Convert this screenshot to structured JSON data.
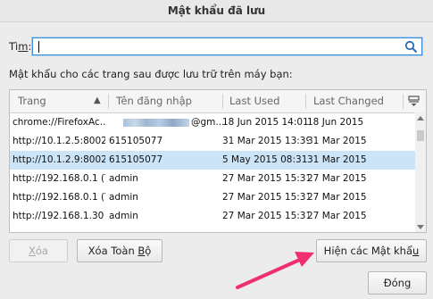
{
  "window": {
    "title": "Mật khẩu đã lưu"
  },
  "search": {
    "label_prefix": "Tì",
    "label_accel": "m",
    "label_suffix": ":",
    "value": ""
  },
  "description": "Mật khẩu cho các trang sau được lưu trữ trên máy bạn:",
  "table": {
    "columns": [
      "Trang",
      "Tên đăng nhập",
      "Last Used",
      "Last Changed"
    ],
    "sort": {
      "column": "Trang",
      "direction": "ascending"
    },
    "rows": [
      {
        "site": "chrome://FirefoxAc...",
        "username": "@gm...",
        "last_used": "18 Jun 2015 14:01",
        "last_changed": "18 Jun 2015",
        "selected": false
      },
      {
        "site": "http://10.1.2.5:8002",
        "username": "615105077",
        "last_used": "31 Mar 2015 13:39",
        "last_changed": "31 Mar 2015",
        "selected": false
      },
      {
        "site": "http://10.1.2.9:8002",
        "username": "615105077",
        "last_used": "5 May 2015 08:31",
        "last_changed": "31 Mar 2015",
        "selected": true
      },
      {
        "site": "http://192.168.0.1 (T...",
        "username": "admin",
        "last_used": "27 Mar 2015 15:31",
        "last_changed": "27 Mar 2015",
        "selected": false
      },
      {
        "site": "http://192.168.0.1 (T...",
        "username": "admin",
        "last_used": "27 Mar 2015 15:31",
        "last_changed": "27 Mar 2015",
        "selected": false
      },
      {
        "site": "http://192.168.1.30",
        "username": "admin",
        "last_used": "27 Mar 2015 15:31",
        "last_changed": "27 Mar 2015",
        "selected": false
      }
    ]
  },
  "buttons": {
    "remove": {
      "prefix": "",
      "accel": "X",
      "suffix": "óa",
      "enabled": false
    },
    "remove_all": {
      "prefix": "Xóa Toàn ",
      "accel": "B",
      "suffix": "ộ",
      "enabled": true
    },
    "show_passwords": {
      "prefix": "Hiện các Mật khẩ",
      "accel": "u",
      "suffix": "",
      "enabled": true
    },
    "close": {
      "prefix": "Đón",
      "accel": "g",
      "suffix": "",
      "enabled": true
    }
  },
  "annotation": {
    "arrow_color": "#f0306e",
    "points_to": "show_passwords"
  },
  "colors": {
    "selection": "#cce4f7",
    "focus": "#3d8fd9"
  }
}
